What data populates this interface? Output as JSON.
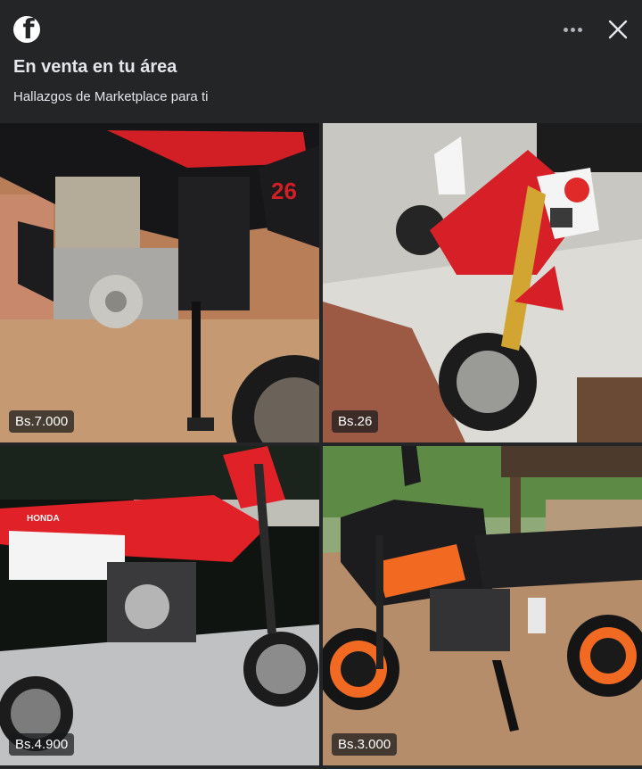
{
  "header": {
    "logo_icon": "facebook-icon",
    "more_icon": "more-horizontal-icon",
    "close_icon": "close-icon",
    "title": "En venta en tu área",
    "subtitle": "Hallazgos de Marketplace para ti"
  },
  "listings": [
    {
      "price": "Bs.7.000",
      "image_icon": "motorcycle-engine-photo"
    },
    {
      "price": "Bs.26",
      "image_icon": "red-dirt-bike-photo"
    },
    {
      "price": "Bs.4.900",
      "image_icon": "red-white-dirt-bike-photo"
    },
    {
      "price": "Bs.3.000",
      "image_icon": "black-orange-street-bike-photo"
    }
  ],
  "colors": {
    "background": "#242526",
    "text": "#e4e6eb",
    "accent_red": "#d61f26",
    "accent_orange": "#f26a21"
  }
}
